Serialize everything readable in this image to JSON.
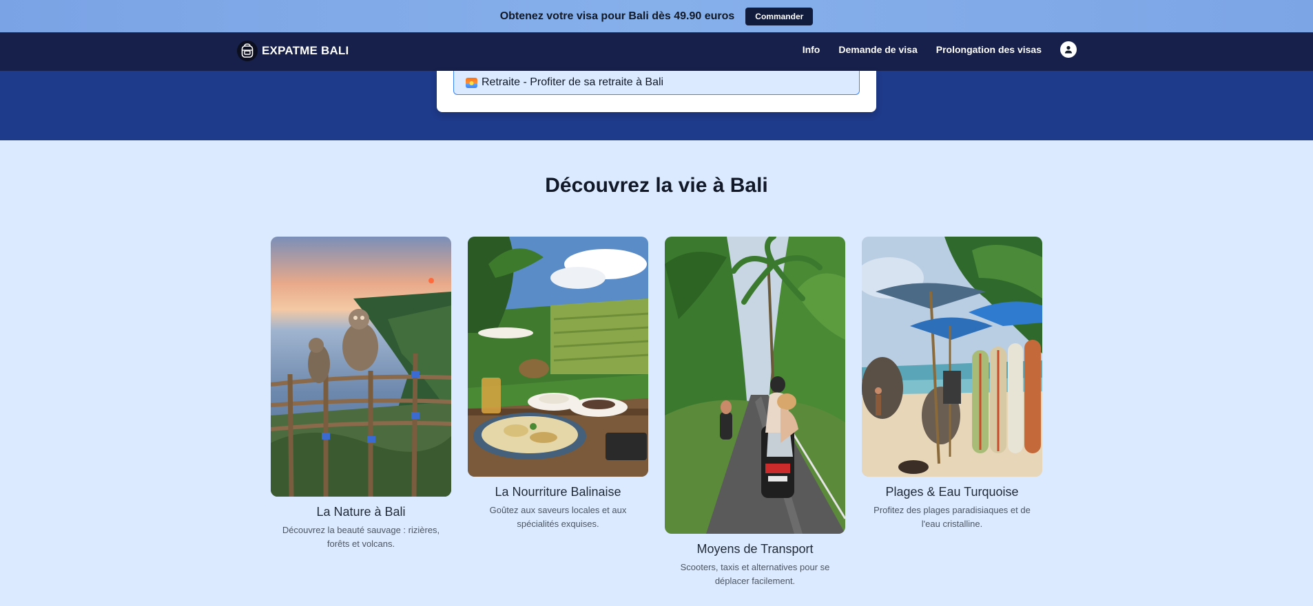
{
  "promo": {
    "text": "Obtenez votre visa pour Bali dès 49.90 euros",
    "button": "Commander"
  },
  "nav": {
    "brand": "EXPATME BALI",
    "links": [
      "Info",
      "Demande de visa",
      "Prolongation des visas"
    ],
    "user_icon": "user-icon"
  },
  "selector": {
    "option": "Retraite - Profiter de sa retraite à Bali",
    "icon": "sunrise-icon"
  },
  "section": {
    "title": "Découvrez la vie à Bali"
  },
  "cards": [
    {
      "title": "La Nature à Bali",
      "desc": "Découvrez la beauté sauvage : rizières, forêts et volcans."
    },
    {
      "title": "La Nourriture Balinaise",
      "desc": "Goûtez aux saveurs locales et aux spécialités exquises."
    },
    {
      "title": "Moyens de Transport",
      "desc": "Scooters, taxis et alternatives pour se déplacer facilement."
    },
    {
      "title": "Plages & Eau Turquoise",
      "desc": "Profitez des plages paradisiaques et de l'eau cristalline."
    }
  ],
  "colors": {
    "promo_bg": "#7aa3e5",
    "nav_bg": "#17204a",
    "hero_bg": "#1e3a8a",
    "page_bg": "#dbeafe",
    "option_border": "#3b82f6"
  }
}
